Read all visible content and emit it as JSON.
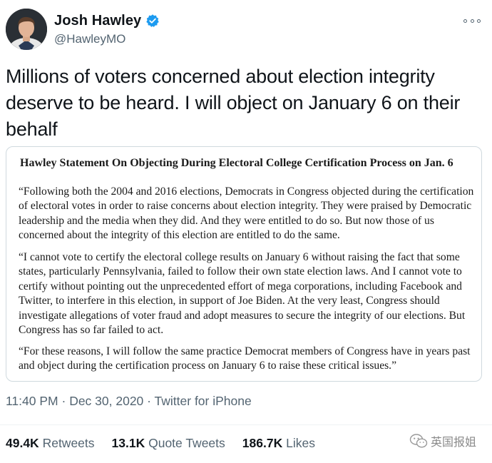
{
  "author": {
    "display_name": "Josh Hawley",
    "handle": "@HawleyMO",
    "verified_icon": "verified-badge-icon",
    "avatar_icon": "profile-photo"
  },
  "tweet_text": "Millions of voters concerned about election integrity deserve to be heard. I will object on January 6 on their behalf",
  "statement": {
    "title": "Hawley Statement On Objecting During Electoral College Certification Process on Jan. 6",
    "paragraphs": [
      "“Following both the 2004 and 2016 elections, Democrats in Congress objected during the certification of electoral votes in order to raise concerns about election integrity. They were praised by Democratic leadership and the media when they did. And they were entitled to do so. But now those of us concerned about the integrity of this election are entitled to do the same.",
      "“I cannot vote to certify the electoral college results on January 6 without raising the fact that some states, particularly Pennsylvania, failed to follow their own state election laws. And I cannot vote to certify without pointing out the unprecedented effort of mega corporations, including Facebook and Twitter, to interfere in this election, in support of Joe Biden. At the very least, Congress should investigate allegations of voter fraud and adopt measures to secure the integrity of our elections. But Congress has so far failed to act.",
      "“For these reasons, I will follow the same practice Democrat members of Congress have in years past and object during the certification process on January 6 to raise these critical issues.”"
    ]
  },
  "meta": {
    "time": "11:40 PM",
    "separator": "·",
    "date": "Dec 30, 2020",
    "source": "Twitter for iPhone"
  },
  "stats": {
    "retweets_count": "49.4K",
    "retweets_label": "Retweets",
    "quotes_count": "13.1K",
    "quotes_label": "Quote Tweets",
    "likes_count": "186.7K",
    "likes_label": "Likes"
  },
  "watermark": {
    "text": "英国报姐",
    "icon": "wechat-icon"
  },
  "colors": {
    "text_primary": "#0f1419",
    "text_secondary": "#536471",
    "verified_blue": "#1d9bf0",
    "card_border": "#cfd9de"
  }
}
